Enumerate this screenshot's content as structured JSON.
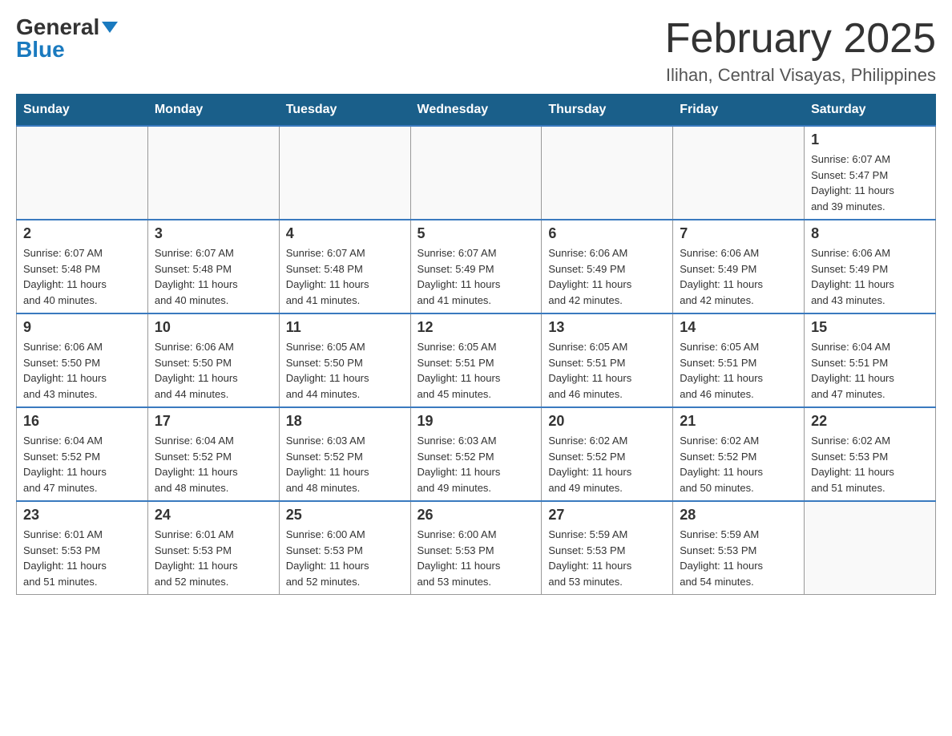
{
  "header": {
    "logo_general": "General",
    "logo_blue": "Blue",
    "month_title": "February 2025",
    "location": "Ilihan, Central Visayas, Philippines"
  },
  "weekdays": [
    "Sunday",
    "Monday",
    "Tuesday",
    "Wednesday",
    "Thursday",
    "Friday",
    "Saturday"
  ],
  "weeks": [
    [
      {
        "day": "",
        "info": ""
      },
      {
        "day": "",
        "info": ""
      },
      {
        "day": "",
        "info": ""
      },
      {
        "day": "",
        "info": ""
      },
      {
        "day": "",
        "info": ""
      },
      {
        "day": "",
        "info": ""
      },
      {
        "day": "1",
        "info": "Sunrise: 6:07 AM\nSunset: 5:47 PM\nDaylight: 11 hours\nand 39 minutes."
      }
    ],
    [
      {
        "day": "2",
        "info": "Sunrise: 6:07 AM\nSunset: 5:48 PM\nDaylight: 11 hours\nand 40 minutes."
      },
      {
        "day": "3",
        "info": "Sunrise: 6:07 AM\nSunset: 5:48 PM\nDaylight: 11 hours\nand 40 minutes."
      },
      {
        "day": "4",
        "info": "Sunrise: 6:07 AM\nSunset: 5:48 PM\nDaylight: 11 hours\nand 41 minutes."
      },
      {
        "day": "5",
        "info": "Sunrise: 6:07 AM\nSunset: 5:49 PM\nDaylight: 11 hours\nand 41 minutes."
      },
      {
        "day": "6",
        "info": "Sunrise: 6:06 AM\nSunset: 5:49 PM\nDaylight: 11 hours\nand 42 minutes."
      },
      {
        "day": "7",
        "info": "Sunrise: 6:06 AM\nSunset: 5:49 PM\nDaylight: 11 hours\nand 42 minutes."
      },
      {
        "day": "8",
        "info": "Sunrise: 6:06 AM\nSunset: 5:49 PM\nDaylight: 11 hours\nand 43 minutes."
      }
    ],
    [
      {
        "day": "9",
        "info": "Sunrise: 6:06 AM\nSunset: 5:50 PM\nDaylight: 11 hours\nand 43 minutes."
      },
      {
        "day": "10",
        "info": "Sunrise: 6:06 AM\nSunset: 5:50 PM\nDaylight: 11 hours\nand 44 minutes."
      },
      {
        "day": "11",
        "info": "Sunrise: 6:05 AM\nSunset: 5:50 PM\nDaylight: 11 hours\nand 44 minutes."
      },
      {
        "day": "12",
        "info": "Sunrise: 6:05 AM\nSunset: 5:51 PM\nDaylight: 11 hours\nand 45 minutes."
      },
      {
        "day": "13",
        "info": "Sunrise: 6:05 AM\nSunset: 5:51 PM\nDaylight: 11 hours\nand 46 minutes."
      },
      {
        "day": "14",
        "info": "Sunrise: 6:05 AM\nSunset: 5:51 PM\nDaylight: 11 hours\nand 46 minutes."
      },
      {
        "day": "15",
        "info": "Sunrise: 6:04 AM\nSunset: 5:51 PM\nDaylight: 11 hours\nand 47 minutes."
      }
    ],
    [
      {
        "day": "16",
        "info": "Sunrise: 6:04 AM\nSunset: 5:52 PM\nDaylight: 11 hours\nand 47 minutes."
      },
      {
        "day": "17",
        "info": "Sunrise: 6:04 AM\nSunset: 5:52 PM\nDaylight: 11 hours\nand 48 minutes."
      },
      {
        "day": "18",
        "info": "Sunrise: 6:03 AM\nSunset: 5:52 PM\nDaylight: 11 hours\nand 48 minutes."
      },
      {
        "day": "19",
        "info": "Sunrise: 6:03 AM\nSunset: 5:52 PM\nDaylight: 11 hours\nand 49 minutes."
      },
      {
        "day": "20",
        "info": "Sunrise: 6:02 AM\nSunset: 5:52 PM\nDaylight: 11 hours\nand 49 minutes."
      },
      {
        "day": "21",
        "info": "Sunrise: 6:02 AM\nSunset: 5:52 PM\nDaylight: 11 hours\nand 50 minutes."
      },
      {
        "day": "22",
        "info": "Sunrise: 6:02 AM\nSunset: 5:53 PM\nDaylight: 11 hours\nand 51 minutes."
      }
    ],
    [
      {
        "day": "23",
        "info": "Sunrise: 6:01 AM\nSunset: 5:53 PM\nDaylight: 11 hours\nand 51 minutes."
      },
      {
        "day": "24",
        "info": "Sunrise: 6:01 AM\nSunset: 5:53 PM\nDaylight: 11 hours\nand 52 minutes."
      },
      {
        "day": "25",
        "info": "Sunrise: 6:00 AM\nSunset: 5:53 PM\nDaylight: 11 hours\nand 52 minutes."
      },
      {
        "day": "26",
        "info": "Sunrise: 6:00 AM\nSunset: 5:53 PM\nDaylight: 11 hours\nand 53 minutes."
      },
      {
        "day": "27",
        "info": "Sunrise: 5:59 AM\nSunset: 5:53 PM\nDaylight: 11 hours\nand 53 minutes."
      },
      {
        "day": "28",
        "info": "Sunrise: 5:59 AM\nSunset: 5:53 PM\nDaylight: 11 hours\nand 54 minutes."
      },
      {
        "day": "",
        "info": ""
      }
    ]
  ]
}
